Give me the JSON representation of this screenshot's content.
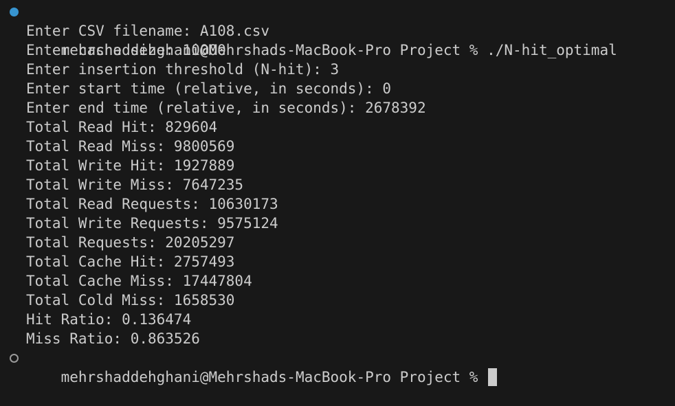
{
  "terminal": {
    "first_prompt": {
      "status_color": "#3794cf",
      "text": "mehrshaddehghani@Mehrshads-MacBook-Pro Project % ./N-hit_optimal"
    },
    "output_lines": [
      "Enter CSV filename: A108.csv",
      "Enter cache size: 10000",
      "Enter insertion threshold (N-hit): 3",
      "Enter start time (relative, in seconds): 0",
      "Enter end time (relative, in seconds): 2678392",
      "Total Read Hit: 829604",
      "Total Read Miss: 9800569",
      "Total Write Hit: 1927889",
      "Total Write Miss: 7647235",
      "Total Read Requests: 10630173",
      "Total Write Requests: 9575124",
      "Total Requests: 20205297",
      "Total Cache Hit: 2757493",
      "Total Cache Miss: 17447804",
      "Total Cold Miss: 1658530",
      "Hit Ratio: 0.136474",
      "Miss Ratio: 0.863526"
    ],
    "last_prompt": {
      "text": "mehrshaddehghani@Mehrshads-MacBook-Pro Project % "
    }
  }
}
